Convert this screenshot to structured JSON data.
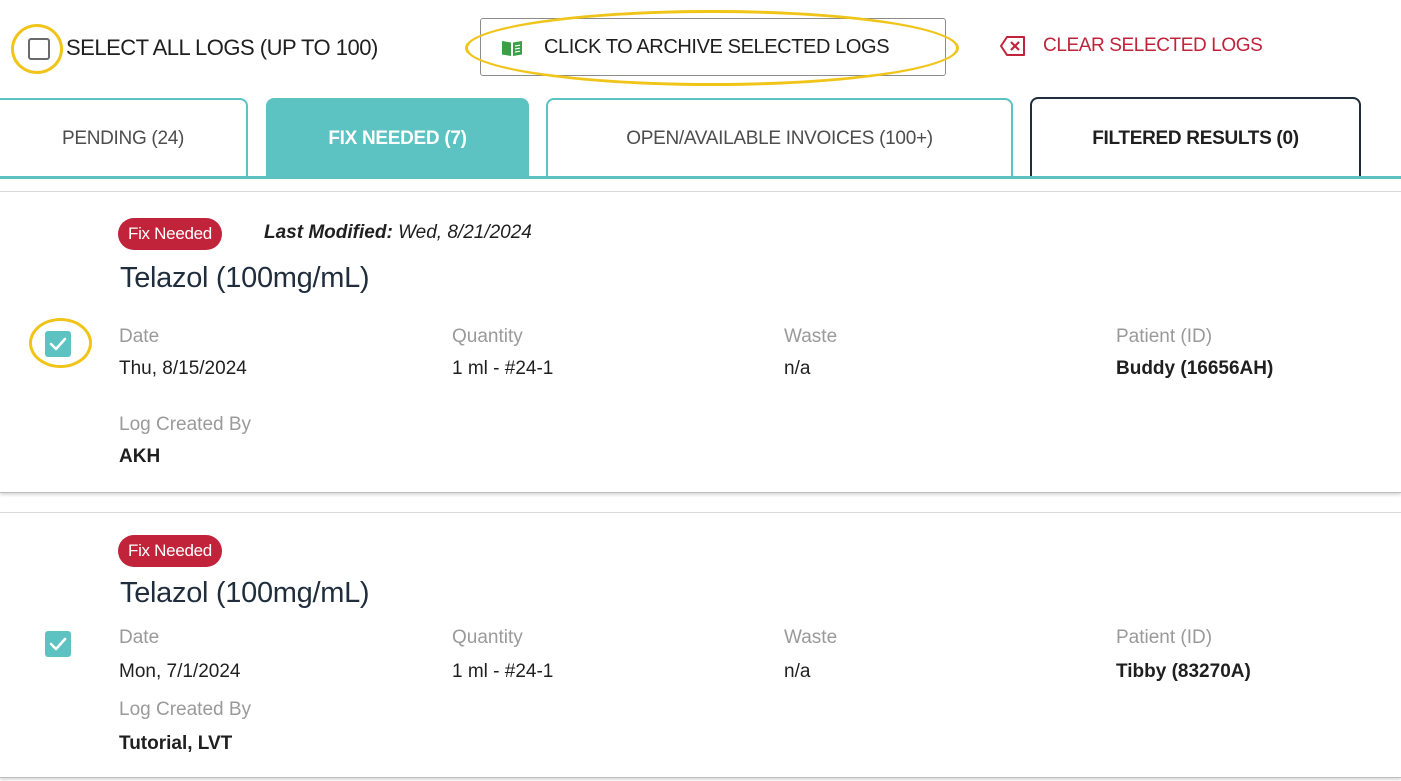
{
  "toolbar": {
    "select_all_label": "SELECT ALL LOGS (UP TO 100)",
    "archive_label": "CLICK TO ARCHIVE SELECTED LOGS",
    "archive_icon": "book-open-icon",
    "clear_label": "CLEAR SELECTED LOGS",
    "clear_icon": "backspace-x-icon"
  },
  "tabs": [
    {
      "label": "PENDING (24)",
      "active": false
    },
    {
      "label": "FIX NEEDED (7)",
      "active": true
    },
    {
      "label": "OPEN/AVAILABLE INVOICES (100+)",
      "active": false
    },
    {
      "label": "FILTERED RESULTS (0)",
      "active": false
    }
  ],
  "logs": [
    {
      "status": "Fix Needed",
      "last_modified_label": "Last Modified:",
      "last_modified_value": "Wed, 8/21/2024",
      "drug": "Telazol (100mg/mL)",
      "checked": true,
      "date_label": "Date",
      "date": "Thu, 8/15/2024",
      "quantity_label": "Quantity",
      "quantity": "1 ml - #24-1",
      "waste_label": "Waste",
      "waste": "n/a",
      "patient_label": "Patient (ID)",
      "patient": "Buddy (16656AH)",
      "created_by_label": "Log Created By",
      "created_by": "AKH"
    },
    {
      "status": "Fix Needed",
      "drug": "Telazol (100mg/mL)",
      "checked": true,
      "date_label": "Date",
      "date": "Mon, 7/1/2024",
      "quantity_label": "Quantity",
      "quantity": "1 ml - #24-1",
      "waste_label": "Waste",
      "waste": "n/a",
      "patient_label": "Patient (ID)",
      "patient": "Tibby (83270A)",
      "created_by_label": "Log Created By",
      "created_by": "Tutorial, LVT"
    }
  ],
  "colors": {
    "accent_teal": "#5cc2c2",
    "danger_red": "#c0233a",
    "highlight_yellow": "#f0c419",
    "archive_icon_green": "#3aa046",
    "navy": "#1f2d3d"
  }
}
